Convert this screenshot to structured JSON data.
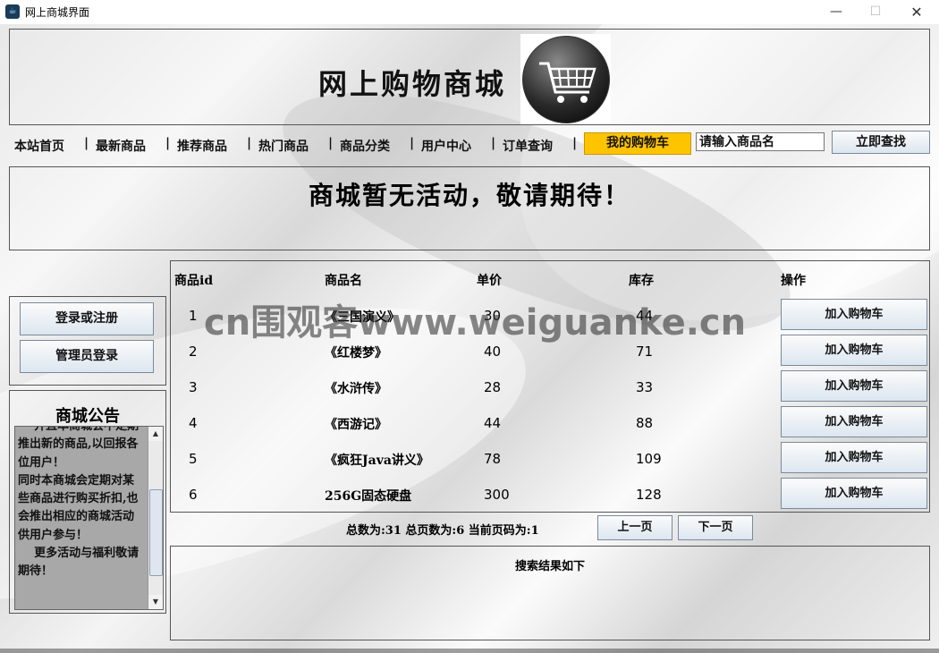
{
  "window": {
    "title": "网上商城界面",
    "minimize": "—",
    "maximize": "☐",
    "close": "✕"
  },
  "header": {
    "site_title": "网上购物商城"
  },
  "nav": {
    "items": [
      "本站首页",
      "最新商品",
      "推荐商品",
      "热门商品",
      "商品分类",
      "用户中心",
      "订单查询"
    ],
    "separator": "|",
    "cart_label": "我的购物车"
  },
  "search": {
    "value": "请输入商品名",
    "button_label": "立即查找"
  },
  "activity": {
    "text": "商城暂无活动，敬请期待！"
  },
  "auth": {
    "login_label": "登录或注册",
    "admin_label": "管理员登录"
  },
  "notice": {
    "title": "商城公告",
    "text": "    并且本商城会不定期推出新的商品,以回报各位用户！\n同时本商城会定期对某些商品进行购买折扣,也会推出相应的商城活动供用户参与！\n    更多活动与福利敬请期待！"
  },
  "table": {
    "headers": [
      "商品id",
      "商品名",
      "单价",
      "库存",
      "操作"
    ],
    "rows": [
      {
        "id": "1",
        "name": "《三国演义》",
        "price": "30",
        "stock": "44",
        "action": "加入购物车"
      },
      {
        "id": "2",
        "name": "《红楼梦》",
        "price": "40",
        "stock": "71",
        "action": "加入购物车"
      },
      {
        "id": "3",
        "name": "《水浒传》",
        "price": "28",
        "stock": "33",
        "action": "加入购物车"
      },
      {
        "id": "4",
        "name": "《西游记》",
        "price": "44",
        "stock": "88",
        "action": "加入购物车"
      },
      {
        "id": "5",
        "name": "《疯狂Java讲义》",
        "price": "78",
        "stock": "109",
        "action": "加入购物车"
      },
      {
        "id": "6",
        "name": "256G固态硬盘",
        "price": "300",
        "stock": "128",
        "action": "加入购物车"
      }
    ]
  },
  "pager": {
    "info": "总数为:31 总页数为:6 当前页码为:1",
    "prev_label": "上一页",
    "next_label": "下一页"
  },
  "result": {
    "text": "搜索结果如下"
  },
  "watermark": {
    "text": "cn围观客www.weiguanke.cn"
  }
}
